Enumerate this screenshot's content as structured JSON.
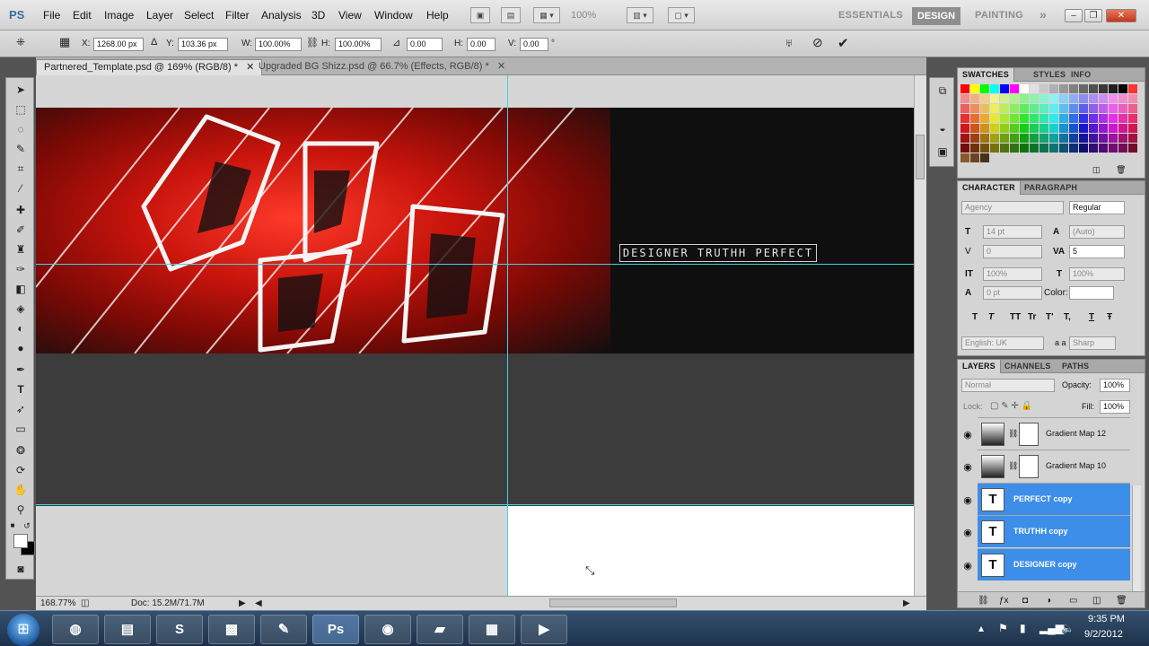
{
  "menubar": {
    "logo": "PS",
    "menus": [
      "File",
      "Edit",
      "Image",
      "Layer",
      "Select",
      "Filter",
      "Analysis",
      "3D",
      "View",
      "Window",
      "Help"
    ],
    "zoom": "100%",
    "workspaces": [
      "ESSENTIALS",
      "DESIGN",
      "PAINTING"
    ],
    "more": "»"
  },
  "options": {
    "x_label": "X:",
    "x_value": "1268.00 px",
    "y_label": "Y:",
    "y_value": "103.36 px",
    "w_label": "W:",
    "w_value": "100.00%",
    "h_label": "H:",
    "h_value": "100.00%",
    "rot_value": "0.00",
    "hskew_label": "H:",
    "hskew_value": "0.00",
    "vskew_label": "V:",
    "vskew_value": "0.00",
    "degree": "°"
  },
  "tabs": [
    {
      "label": "Partnered_Template.psd @ 169% (RGB/8) *",
      "active": true
    },
    {
      "label": "Upgraded BG Shizz.psd @ 66.7% (Effects, RGB/8) *",
      "active": false
    }
  ],
  "canvas": {
    "banner_text": "DESIGNER TRUTHH PERFECT"
  },
  "status": {
    "zoom": "168.77%",
    "doc": "Doc: 15.2M/71.7M"
  },
  "swatches_panel": {
    "tabs": [
      "SWATCHES",
      "STYLES",
      "INFO"
    ]
  },
  "character_panel": {
    "tabs": [
      "CHARACTER",
      "PARAGRAPH"
    ],
    "font_family": "Agency",
    "font_style": "Regular",
    "size": "14 pt",
    "leading": "(Auto)",
    "kerning": "0",
    "tracking": "5",
    "vscale": "100%",
    "hscale": "100%",
    "baseline": "0 pt",
    "color_label": "Color:",
    "type_buttons": [
      "T",
      "T",
      "TT",
      "Tr",
      "T'",
      "T,",
      "T",
      "Ŧ"
    ],
    "language": "English: UK",
    "aa_label": "a a",
    "antialias": "Sharp"
  },
  "layers_panel": {
    "tabs": [
      "LAYERS",
      "CHANNELS",
      "PATHS"
    ],
    "blend_mode": "Normal",
    "opacity_label": "Opacity:",
    "opacity": "100%",
    "lock_label": "Lock:",
    "fill_label": "Fill:",
    "fill": "100%",
    "layers": [
      {
        "name": "Gradient Map 12",
        "kind": "adjustment",
        "selected": false
      },
      {
        "name": "Gradient Map 10",
        "kind": "adjustment",
        "selected": false
      },
      {
        "name": "PERFECT copy",
        "kind": "text",
        "selected": true
      },
      {
        "name": "TRUTHH copy",
        "kind": "text",
        "selected": true
      },
      {
        "name": "DESIGNER copy",
        "kind": "text",
        "selected": true
      }
    ],
    "text_thumb": "T"
  },
  "taskbar": {
    "apps": [
      "chrome",
      "explorer",
      "skype",
      "minecraft",
      "paint",
      "Ps",
      "ie",
      "folder",
      "notes",
      "media"
    ],
    "ps_label": "Ps",
    "time": "9:35 PM",
    "date": "9/2/2012"
  },
  "colors": {
    "guide": "#39d6e8",
    "selection": "#3d8ee8",
    "accent_red": "#c8140c"
  }
}
